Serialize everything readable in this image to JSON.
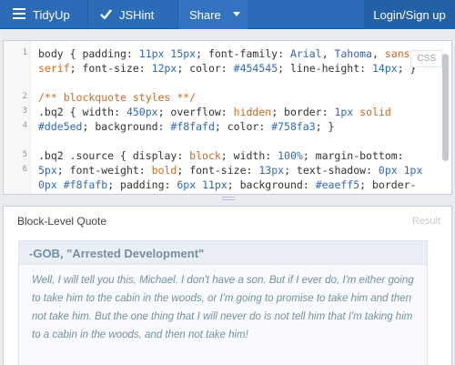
{
  "toolbar": {
    "tidy_label": "TidyUp",
    "jshint_label": "JSHint",
    "share_label": "Share",
    "login_label": "Login/Sign up"
  },
  "editor": {
    "mode_label": "CSS",
    "line_numbers": [
      "1",
      "2",
      "3",
      "4",
      "5",
      "6"
    ],
    "lines": [
      {
        "segments": [
          {
            "t": "body { padding: ",
            "c": ""
          },
          {
            "t": "11px 15px",
            "c": "num"
          },
          {
            "t": "; font-family: ",
            "c": ""
          },
          {
            "t": "Arial",
            "c": "str"
          },
          {
            "t": ", ",
            "c": ""
          },
          {
            "t": "Tahoma",
            "c": "str"
          },
          {
            "t": ", ",
            "c": ""
          },
          {
            "t": "sans",
            "c": "kw"
          }
        ]
      },
      {
        "segments": [
          {
            "t": "serif",
            "c": "kw"
          },
          {
            "t": "; font-size: ",
            "c": ""
          },
          {
            "t": "12px",
            "c": "num"
          },
          {
            "t": "; color: ",
            "c": ""
          },
          {
            "t": "#454545",
            "c": "num"
          },
          {
            "t": "; line-height: ",
            "c": ""
          },
          {
            "t": "14px",
            "c": "num"
          },
          {
            "t": "; }",
            "c": ""
          }
        ]
      },
      {
        "segments": []
      },
      {
        "segments": [
          {
            "t": "/** blockquote styles **/",
            "c": "cm"
          }
        ]
      },
      {
        "segments": [
          {
            "t": ".bq2 { width: ",
            "c": ""
          },
          {
            "t": "450px",
            "c": "num"
          },
          {
            "t": "; overflow: ",
            "c": ""
          },
          {
            "t": "hidden",
            "c": "kw"
          },
          {
            "t": "; border: ",
            "c": ""
          },
          {
            "t": "1px",
            "c": "num"
          },
          {
            "t": " ",
            "c": ""
          },
          {
            "t": "solid",
            "c": "kw"
          }
        ]
      },
      {
        "segments": [
          {
            "t": "#dde5ed",
            "c": "num"
          },
          {
            "t": "; background: ",
            "c": ""
          },
          {
            "t": "#f8fafd",
            "c": "num"
          },
          {
            "t": "; color: ",
            "c": ""
          },
          {
            "t": "#758fa3",
            "c": "num"
          },
          {
            "t": "; }",
            "c": ""
          }
        ]
      },
      {
        "segments": []
      },
      {
        "segments": [
          {
            "t": ".bq2 .source { display: ",
            "c": ""
          },
          {
            "t": "block",
            "c": "kw"
          },
          {
            "t": "; width: ",
            "c": ""
          },
          {
            "t": "100%",
            "c": "num"
          },
          {
            "t": "; margin-bottom:",
            "c": ""
          }
        ]
      },
      {
        "segments": [
          {
            "t": "5px",
            "c": "num"
          },
          {
            "t": "; font-weight: ",
            "c": ""
          },
          {
            "t": "bold",
            "c": "kw"
          },
          {
            "t": "; font-size: ",
            "c": ""
          },
          {
            "t": "13px",
            "c": "num"
          },
          {
            "t": "; text-shadow: ",
            "c": ""
          },
          {
            "t": "0px 1px",
            "c": "num"
          }
        ]
      },
      {
        "segments": [
          {
            "t": "0px",
            "c": "num"
          },
          {
            "t": " ",
            "c": ""
          },
          {
            "t": "#f8fafb",
            "c": "num"
          },
          {
            "t": "; padding: ",
            "c": ""
          },
          {
            "t": "6px 11px",
            "c": "num"
          },
          {
            "t": "; background: ",
            "c": ""
          },
          {
            "t": "#eaeff5",
            "c": "num"
          },
          {
            "t": "; border-",
            "c": ""
          }
        ]
      }
    ]
  },
  "result": {
    "title": "Block-Level Quote",
    "label": "Result",
    "source": "-GOB, \"Arrested Development\"",
    "quote": "Well, I will tell you this, Michael. I don't have a son. But if I ever do, I'm either going to take him to the cabin in the woods, or I'm going to promise to take him and then not take him. But the one thing that I will never do is not tell him that I'm taking him to a cabin in the woods, and then not take him!"
  },
  "colors": {
    "toolbar": "#2c6bb6",
    "quote_text": "#758fa3",
    "quote_bg": "#f8fafd",
    "source_bg": "#eaeff5"
  }
}
